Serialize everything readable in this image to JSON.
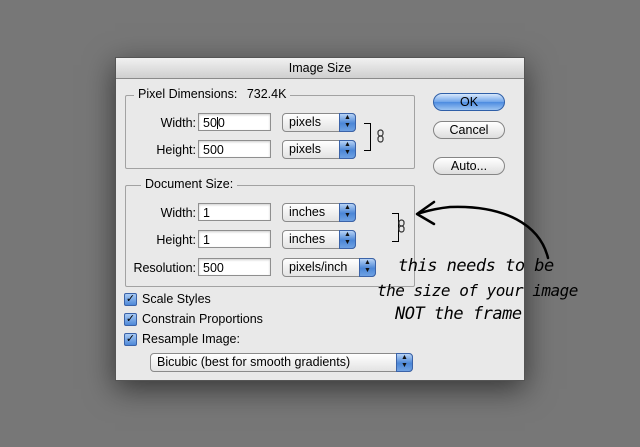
{
  "dialog": {
    "title": "Image Size",
    "buttons": {
      "ok": "OK",
      "cancel": "Cancel",
      "auto": "Auto..."
    }
  },
  "pixel_dimensions": {
    "legend": "Pixel Dimensions:",
    "size": "732.4K",
    "width_label": "Width:",
    "width_value_a": "50",
    "width_value_b": "0",
    "width_unit": "pixels",
    "height_label": "Height:",
    "height_value": "500",
    "height_unit": "pixels"
  },
  "document_size": {
    "legend": "Document Size:",
    "width_label": "Width:",
    "width_value": "1",
    "width_unit": "inches",
    "height_label": "Height:",
    "height_value": "1",
    "height_unit": "inches",
    "resolution_label": "Resolution:",
    "resolution_value": "500",
    "resolution_unit": "pixels/inch"
  },
  "options": {
    "scale_styles": {
      "label": "Scale Styles",
      "checked": true
    },
    "constrain_proportions": {
      "label": "Constrain Proportions",
      "checked": true
    },
    "resample_image": {
      "label": "Resample Image:",
      "checked": true
    },
    "resample_method": "Bicubic (best for smooth gradients)"
  },
  "annotation": {
    "line1": "this needs to be",
    "line2": "the size of your image",
    "line3": "NOT the frame"
  },
  "icons": [
    "link-icon",
    "checkmark-icon",
    "popup-arrows-icon",
    "hand-drawn-arrow"
  ]
}
